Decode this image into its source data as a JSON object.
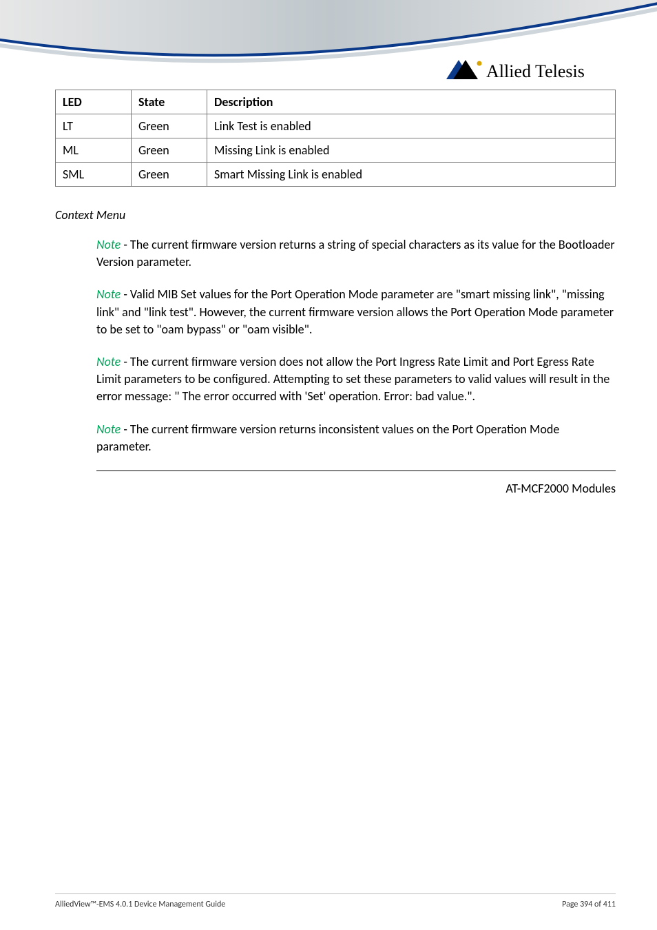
{
  "logo_text": "Allied Telesis",
  "table": {
    "headers": [
      "LED",
      "State",
      "Description"
    ],
    "rows": [
      {
        "led": "LT",
        "state": "Green",
        "desc": "Link Test is enabled"
      },
      {
        "led": "ML",
        "state": "Green",
        "desc": "Missing Link is enabled"
      },
      {
        "led": "SML",
        "state": "Green",
        "desc": "Smart Missing Link is enabled"
      }
    ]
  },
  "section_heading": "Context Menu",
  "note_label": "Note",
  "notes": [
    " - The current firmware version returns a string of special characters as its value for the Bootloader Version parameter.",
    " - Valid MIB Set values for the Port Operation Mode parameter are \"smart missing link\", \"missing link\" and \"link test\". However, the current firmware version allows the Port Operation Mode parameter to be set to \"oam bypass\" or \"oam visible\".",
    " - The current firmware version does not allow the Port Ingress Rate Limit and Port Egress Rate Limit parameters to be configured. Attempting to set these parameters to valid values will result in the error message: \" The error occurred with 'Set' operation. Error: bad value.\".",
    " - The current firmware version returns inconsistent values on the Port Operation Mode parameter."
  ],
  "right_label": "AT-MCF2000 Modules",
  "footer": {
    "left": "AlliedView™-EMS 4.0.1 Device Management Guide",
    "right": "Page 394 of 411"
  }
}
